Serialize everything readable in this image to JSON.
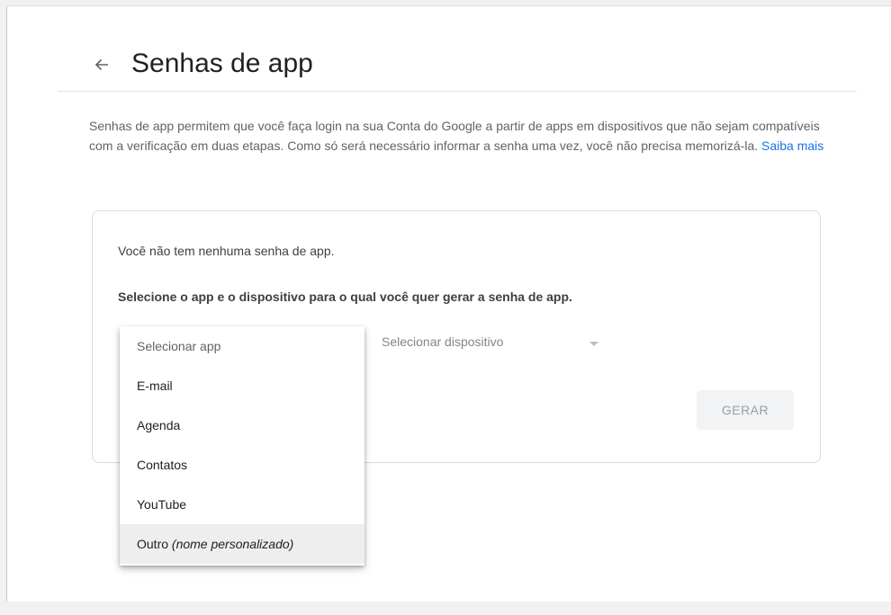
{
  "header": {
    "back_icon": "arrow-back-icon",
    "title": "Senhas de app"
  },
  "description": {
    "text": "Senhas de app permitem que você faça login na sua Conta do Google a partir de apps em dispositivos que não sejam compatíveis com a verificação em duas etapas. Como só será necessário informar a senha uma vez, você não precisa memorizá-la.",
    "link": "Saiba mais"
  },
  "card": {
    "no_passwords": "Você não tem nenhuma senha de app.",
    "instruction": "Selecione o app e o dispositivo para o qual você quer gerar a senha de app.",
    "device_placeholder": "Selecionar dispositivo",
    "generate_label": "GERAR"
  },
  "app_menu": {
    "placeholder": "Selecionar app",
    "items": [
      "E-mail",
      "Agenda",
      "Contatos",
      "YouTube"
    ],
    "custom": {
      "label": "Outro",
      "hint": "(nome personalizado)"
    }
  },
  "colors": {
    "link": "#1a73e8",
    "text_secondary": "#5f6368",
    "disabled_button_bg": "#f1f3f4"
  }
}
